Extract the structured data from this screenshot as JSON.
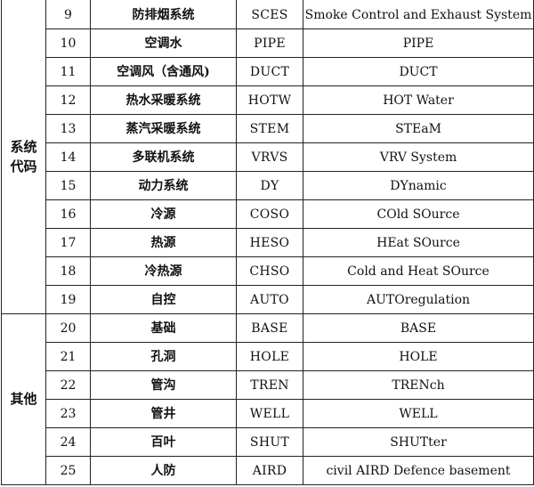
{
  "groups": [
    {
      "label_lines": [
        "系统",
        "代码"
      ],
      "rows": [
        {
          "num": "9",
          "name": "防排烟系统",
          "code": "SCES",
          "desc": "Smoke Control and Exhaust System"
        },
        {
          "num": "10",
          "name": "空调水",
          "code": "PIPE",
          "desc": "PIPE"
        },
        {
          "num": "11",
          "name": "空调风（含通风)",
          "code": "DUCT",
          "desc": "DUCT"
        },
        {
          "num": "12",
          "name": "热水采暖系统",
          "code": "HOTW",
          "desc": "HOT Water"
        },
        {
          "num": "13",
          "name": "蒸汽采暖系统",
          "code": "STEM",
          "desc": "STEaM"
        },
        {
          "num": "14",
          "name": "多联机系统",
          "code": "VRVS",
          "desc": "VRV System"
        },
        {
          "num": "15",
          "name": "动力系统",
          "code": "DY",
          "desc": "DYnamic"
        },
        {
          "num": "16",
          "name": "冷源",
          "code": "COSO",
          "desc": "COld SOurce"
        },
        {
          "num": "17",
          "name": "热源",
          "code": "HESO",
          "desc": "HEat SOurce"
        },
        {
          "num": "18",
          "name": "冷热源",
          "code": "CHSO",
          "desc": "Cold and Heat SOurce"
        },
        {
          "num": "19",
          "name": "自控",
          "code": "AUTO",
          "desc": "AUTOregulation"
        }
      ]
    },
    {
      "label_lines": [
        "其他"
      ],
      "rows": [
        {
          "num": "20",
          "name": "基础",
          "code": "BASE",
          "desc": "BASE"
        },
        {
          "num": "21",
          "name": "孔洞",
          "code": "HOLE",
          "desc": "HOLE"
        },
        {
          "num": "22",
          "name": "管沟",
          "code": "TREN",
          "desc": "TRENch"
        },
        {
          "num": "23",
          "name": "管井",
          "code": "WELL",
          "desc": "WELL"
        },
        {
          "num": "24",
          "name": "百叶",
          "code": "SHUT",
          "desc": "SHUTter"
        },
        {
          "num": "25",
          "name": "人防",
          "code": "AIRD",
          "desc": "civil AIRD Defence basement"
        }
      ]
    }
  ]
}
